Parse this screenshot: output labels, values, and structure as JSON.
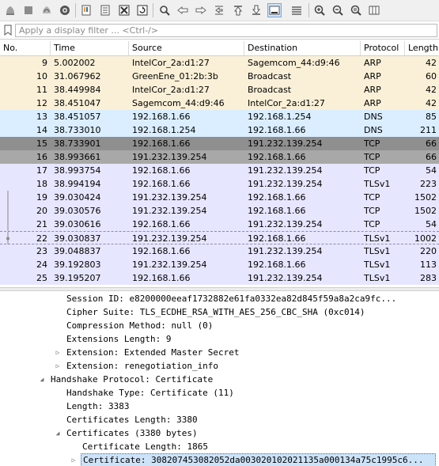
{
  "toolbar": {
    "icons": [
      {
        "name": "start-capture-icon"
      },
      {
        "name": "stop-capture-icon"
      },
      {
        "name": "restart-capture-icon"
      },
      {
        "name": "capture-options-icon"
      },
      {
        "name": "open-file-icon"
      },
      {
        "name": "save-file-icon"
      },
      {
        "name": "close-file-icon"
      },
      {
        "name": "reload-file-icon"
      },
      {
        "name": "find-packet-icon"
      },
      {
        "name": "go-back-icon"
      },
      {
        "name": "go-forward-icon"
      },
      {
        "name": "go-to-packet-icon"
      },
      {
        "name": "go-first-packet-icon"
      },
      {
        "name": "go-last-packet-icon"
      },
      {
        "name": "auto-scroll-icon"
      },
      {
        "name": "colorize-icon"
      },
      {
        "name": "zoom-in-icon"
      },
      {
        "name": "zoom-out-icon"
      },
      {
        "name": "normal-size-icon"
      },
      {
        "name": "resize-columns-icon"
      }
    ]
  },
  "filter": {
    "placeholder": "Apply a display filter ... <Ctrl-/>",
    "value": ""
  },
  "packet_list": {
    "columns": [
      "No.",
      "Time",
      "Source",
      "Destination",
      "Protocol",
      "Length"
    ],
    "rows": [
      {
        "no": "9",
        "time": "5.002002",
        "src": "IntelCor_2a:d1:27",
        "dst": "Sagemcom_44:d9:46",
        "proto": "ARP",
        "len": "42",
        "kind": "arp"
      },
      {
        "no": "10",
        "time": "31.067962",
        "src": "GreenEne_01:2b:3b",
        "dst": "Broadcast",
        "proto": "ARP",
        "len": "60",
        "kind": "arp"
      },
      {
        "no": "11",
        "time": "38.449984",
        "src": "IntelCor_2a:d1:27",
        "dst": "Broadcast",
        "proto": "ARP",
        "len": "42",
        "kind": "arp"
      },
      {
        "no": "12",
        "time": "38.451047",
        "src": "Sagemcom_44:d9:46",
        "dst": "IntelCor_2a:d1:27",
        "proto": "ARP",
        "len": "42",
        "kind": "arp"
      },
      {
        "no": "13",
        "time": "38.451057",
        "src": "192.168.1.66",
        "dst": "192.168.1.254",
        "proto": "DNS",
        "len": "85",
        "kind": "udp"
      },
      {
        "no": "14",
        "time": "38.733010",
        "src": "192.168.1.254",
        "dst": "192.168.1.66",
        "proto": "DNS",
        "len": "211",
        "kind": "udp"
      },
      {
        "no": "15",
        "time": "38.733901",
        "src": "192.168.1.66",
        "dst": "191.232.139.254",
        "proto": "TCP",
        "len": "66",
        "kind": "sel"
      },
      {
        "no": "16",
        "time": "38.993661",
        "src": "191.232.139.254",
        "dst": "192.168.1.66",
        "proto": "TCP",
        "len": "66",
        "kind": "sel2"
      },
      {
        "no": "17",
        "time": "38.993754",
        "src": "192.168.1.66",
        "dst": "191.232.139.254",
        "proto": "TCP",
        "len": "54",
        "kind": "tcp"
      },
      {
        "no": "18",
        "time": "38.994194",
        "src": "192.168.1.66",
        "dst": "191.232.139.254",
        "proto": "TLSv1",
        "len": "223",
        "kind": "tcp"
      },
      {
        "no": "19",
        "time": "39.030424",
        "src": "191.232.139.254",
        "dst": "192.168.1.66",
        "proto": "TCP",
        "len": "1502",
        "kind": "tcp"
      },
      {
        "no": "20",
        "time": "39.030576",
        "src": "191.232.139.254",
        "dst": "192.168.1.66",
        "proto": "TCP",
        "len": "1502",
        "kind": "tcp"
      },
      {
        "no": "21",
        "time": "39.030616",
        "src": "192.168.1.66",
        "dst": "191.232.139.254",
        "proto": "TCP",
        "len": "54",
        "kind": "tcp"
      },
      {
        "no": "22",
        "time": "39.030837",
        "src": "191.232.139.254",
        "dst": "192.168.1.66",
        "proto": "TLSv1",
        "len": "1002",
        "kind": "tls-bordered"
      },
      {
        "no": "23",
        "time": "39.048837",
        "src": "192.168.1.66",
        "dst": "191.232.139.254",
        "proto": "TLSv1",
        "len": "220",
        "kind": "tcp"
      },
      {
        "no": "24",
        "time": "39.192803",
        "src": "191.232.139.254",
        "dst": "192.168.1.66",
        "proto": "TLSv1",
        "len": "113",
        "kind": "tcp"
      },
      {
        "no": "25",
        "time": "39.195207",
        "src": "192.168.1.66",
        "dst": "191.232.139.254",
        "proto": "TLSv1",
        "len": "283",
        "kind": "tcp"
      }
    ]
  },
  "details": {
    "lines": [
      {
        "text": "Session ID: e8200000eeaf1732882e61fa0332ea82d845f59a8a2ca9fc...",
        "toggle": "",
        "selected": false
      },
      {
        "text": "Cipher Suite: TLS_ECDHE_RSA_WITH_AES_256_CBC_SHA (0xc014)",
        "toggle": "",
        "selected": false
      },
      {
        "text": "Compression Method: null (0)",
        "toggle": "",
        "selected": false
      },
      {
        "text": "Extensions Length: 9",
        "toggle": "",
        "selected": false
      },
      {
        "text": "Extension: Extended Master Secret",
        "toggle": "▷",
        "selected": false
      },
      {
        "text": "Extension: renegotiation_info",
        "toggle": "▷",
        "selected": false
      },
      {
        "text": "Handshake Protocol: Certificate",
        "toggle": "◢",
        "selected": false
      },
      {
        "text": "Handshake Type: Certificate (11)",
        "toggle": "",
        "selected": false
      },
      {
        "text": "Length: 3383",
        "toggle": "",
        "selected": false
      },
      {
        "text": "Certificates Length: 3380",
        "toggle": "",
        "selected": false
      },
      {
        "text": "Certificates (3380 bytes)",
        "toggle": "◢",
        "selected": false
      },
      {
        "text": "Certificate Length: 1865",
        "toggle": "",
        "selected": false
      },
      {
        "text": "Certificate: 308207453082052da003020102021135a000134a75c1995c6...",
        "toggle": "▷",
        "selected": true
      }
    ]
  }
}
